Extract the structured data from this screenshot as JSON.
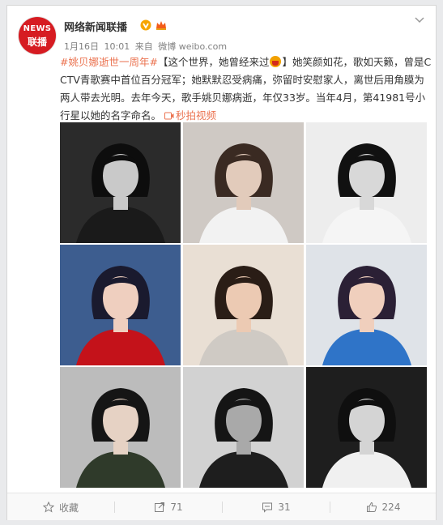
{
  "account": {
    "avatar_top": "NEWS",
    "avatar_bottom": "联播",
    "name": "网络新闻联播"
  },
  "meta": {
    "date": "1月16日",
    "time": "10:01",
    "source_prefix": "来自",
    "source": "微博 weibo.com"
  },
  "post": {
    "hashtag": "#姚贝娜逝世一周年#",
    "text_part1": "【这个世界，她曾经来过",
    "text_part2": "】她笑颜如花，歌如天籁，曾是CCTV青歌赛中首位百分冠军；她默默忍受病痛，弥留时安慰家人，离世后用角膜为两人带去光明。去年今天，歌手姚贝娜病逝，年仅33岁。当年4月，第41981号小行星以她的名字命名。",
    "video_link": "秒拍视频"
  },
  "photos": [
    {
      "bg": "#2b2b2b",
      "skin": "#c9c9c9",
      "hair": "#0d0d0d",
      "cloth": "#1a1a1a"
    },
    {
      "bg": "#cfc9c4",
      "skin": "#e2cbbb",
      "hair": "#3a2a22",
      "cloth": "#f2f2f2"
    },
    {
      "bg": "#ededed",
      "skin": "#d8d8d8",
      "hair": "#111111",
      "cloth": "#f5f5f5"
    },
    {
      "bg": "#3d5d8f",
      "skin": "#efcfbf",
      "hair": "#1a1a2e",
      "cloth": "#c4121a"
    },
    {
      "bg": "#e9dfd4",
      "skin": "#eccab3",
      "hair": "#2a1d16",
      "cloth": "#cfcac4"
    },
    {
      "bg": "#dfe3e8",
      "skin": "#f0cfbd",
      "hair": "#2b2035",
      "cloth": "#2f74c8"
    },
    {
      "bg": "#bcbcbc",
      "skin": "#e6d2c4",
      "hair": "#151515",
      "cloth": "#2f3a2a"
    },
    {
      "bg": "#d2d2d2",
      "skin": "#a9a9a9",
      "hair": "#151515",
      "cloth": "#1e1e1e"
    },
    {
      "bg": "#1e1e1e",
      "skin": "#d4d4d4",
      "hair": "#0f0f0f",
      "cloth": "#f0f0f0"
    }
  ],
  "footer": {
    "favorite_label": "收藏",
    "repost_count": "71",
    "comment_count": "31",
    "like_count": "224"
  },
  "colors": {
    "link": "#eb7350",
    "brand_red": "#d61c22"
  }
}
